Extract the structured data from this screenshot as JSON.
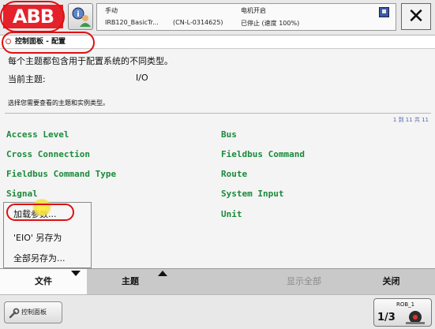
{
  "header": {
    "logo_text": "ABB",
    "mode": "手动",
    "controller": "IRB120_BasicTr...",
    "system_id": "(CN-L-0314625)",
    "motor_state": "电机开启",
    "run_state": "已停止 (速度 100%)",
    "close_glyph": "✕"
  },
  "title": "控制面板 - 配置",
  "content": {
    "info_line": "每个主题都包含用于配置系统的不同类型。",
    "current_topic_label": "当前主题:",
    "current_topic_value": "I/O",
    "instruction": "选择您需要查看的主题和实例类型。",
    "pager": "1 到 11 共 11"
  },
  "topics": [
    "Access Level",
    "Bus",
    "Cross Connection",
    "Fieldbus Command",
    "Fieldbus Command Type",
    "Route",
    "Signal",
    "System Input",
    "Unit"
  ],
  "file_menu": {
    "items": [
      "加载参数...",
      "'EIO' 另存为",
      "全部另存为..."
    ]
  },
  "toolbar": {
    "file": "文件",
    "topic": "主题",
    "show_all": "显示全部",
    "close": "关闭"
  },
  "statusbar": {
    "control_panel_tab": "控制面板",
    "rob_label": "ROB_1",
    "rob_fraction": "1/3"
  },
  "colors": {
    "abb_red": "#e5212b",
    "topic_green": "#1a8a3a",
    "annotation_red": "#dd1111"
  }
}
